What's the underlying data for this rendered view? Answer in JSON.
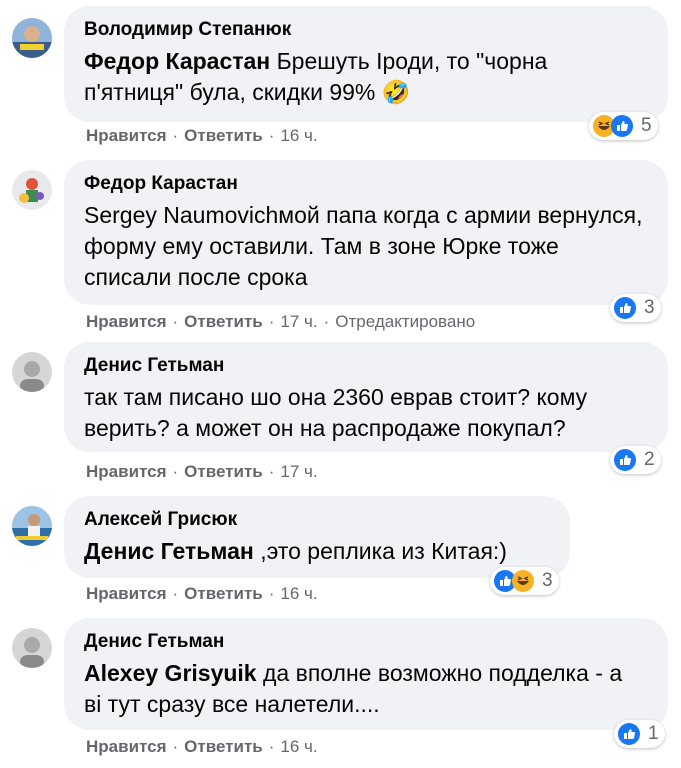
{
  "comments": [
    {
      "author": "Володимир Степанюк",
      "mention": "Федор Карастан",
      "text": " Брешуть Іроди, то \"чорна п'ятниця\" була, скидки 99% 🤣",
      "reactions": [
        "haha",
        "like"
      ],
      "reaction_count": "5",
      "like_label": "Нравится",
      "reply_label": "Ответить",
      "time": "16 ч.",
      "edited": ""
    },
    {
      "author": "Федор Карастан",
      "mention": "",
      "text": "Sergey Naumovichмой папа когда с армии вернулся, форму ему оставили. Там в зоне Юрке тоже списали после срока",
      "reactions": [
        "like"
      ],
      "reaction_count": "3",
      "like_label": "Нравится",
      "reply_label": "Ответить",
      "time": "17 ч.",
      "edited": "Отредактировано"
    },
    {
      "author": "Денис Гетьман",
      "mention": "",
      "text": "так там писано шо она 2360 еврав стоит? кому верить? а может он на распродаже покупал?",
      "reactions": [
        "like"
      ],
      "reaction_count": "2",
      "like_label": "Нравится",
      "reply_label": "Ответить",
      "time": "17 ч.",
      "edited": ""
    },
    {
      "author": "Алексей Грисюк",
      "mention": "Денис Гетьман",
      "text": " ,это реплика из Китая:)",
      "reactions": [
        "like",
        "haha"
      ],
      "reaction_count": "3",
      "like_label": "Нравится",
      "reply_label": "Ответить",
      "time": "16 ч.",
      "edited": ""
    },
    {
      "author": "Денис Гетьман",
      "mention": "Alexey Grisyuik",
      "text": " да вполне возможно подделка - а ві тут сразу все налетели....",
      "reactions": [
        "like"
      ],
      "reaction_count": "1",
      "like_label": "Нравится",
      "reply_label": "Ответить",
      "time": "16 ч.",
      "edited": ""
    }
  ],
  "colors": {
    "bubble": "#f0f2f5",
    "like_blue": "#1877f2",
    "haha_yellow": "#f7b125",
    "meta_gray": "#65676b"
  }
}
